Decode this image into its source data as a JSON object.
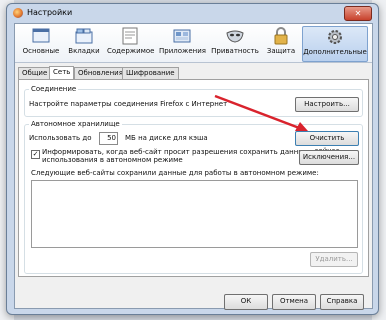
{
  "window": {
    "title": "Настройки",
    "close_glyph": "✕"
  },
  "toolbar": [
    {
      "label": "Основные",
      "icon": "window-icon"
    },
    {
      "label": "Вкладки",
      "icon": "tabs-icon"
    },
    {
      "label": "Содержимое",
      "icon": "content-icon"
    },
    {
      "label": "Приложения",
      "icon": "applications-icon"
    },
    {
      "label": "Приватность",
      "icon": "mask-icon"
    },
    {
      "label": "Защита",
      "icon": "lock-icon"
    },
    {
      "label": "Дополнительные",
      "icon": "gear-icon",
      "active": true
    }
  ],
  "tabs": [
    "Общие",
    "Сеть",
    "Обновления",
    "Шифрование"
  ],
  "connection": {
    "legend": "Соединение",
    "text": "Настройте параметры соединения Firefox с Интернет",
    "button": "Настроить..."
  },
  "offline": {
    "legend": "Автономное хранилище",
    "use_prefix": "Использовать до",
    "cache_value": "50",
    "use_suffix": "МБ на диске для кэша",
    "clear_button": "Очистить сейчас",
    "notify_line1": "Информировать, когда веб-сайт просит разрешения сохранить данные для",
    "notify_line2": "использования в автономном режиме",
    "notify_checked": true,
    "exceptions_button": "Исключения...",
    "sites_label": "Следующие веб-сайты сохранили данные для работы в автономном режиме:",
    "remove_button": "Удалить..."
  },
  "footer": {
    "ok": "ОК",
    "cancel": "Отмена",
    "help": "Справка"
  },
  "colors": {
    "arrow": "#d9232d"
  }
}
